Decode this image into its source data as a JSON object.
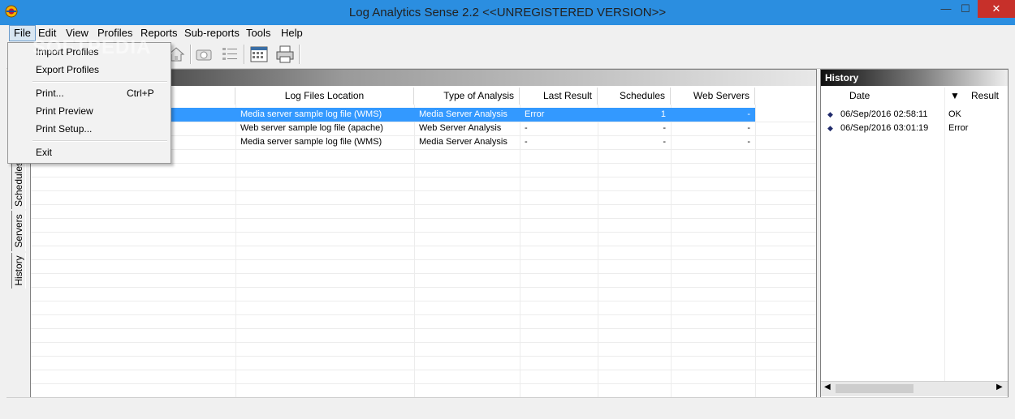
{
  "window": {
    "title": "Log Analytics Sense 2.2 <<UNREGISTERED VERSION>>",
    "controls": {
      "minimize": "—",
      "maximize": "☐",
      "close": "✕"
    }
  },
  "menubar": [
    "File",
    "Edit",
    "View",
    "Profiles",
    "Reports",
    "Sub-reports",
    "Tools",
    "Help"
  ],
  "toolbar": {
    "icons": [
      "home-icon",
      "camera-icon",
      "list-icon",
      "calendar-icon",
      "print-icon"
    ]
  },
  "file_menu": {
    "items": [
      {
        "label": "Import Profiles",
        "shortcut": ""
      },
      {
        "label": "Export Profiles",
        "shortcut": ""
      },
      {
        "label": "Print...",
        "shortcut": "Ctrl+P"
      },
      {
        "label": "Print Preview",
        "shortcut": ""
      },
      {
        "label": "Print Setup...",
        "shortcut": ""
      },
      {
        "label": "Exit",
        "shortcut": ""
      }
    ]
  },
  "side_tabs": [
    "Schedules",
    "Servers",
    "History"
  ],
  "profiles_table": {
    "columns": [
      "Log Files Location",
      "Type of Analysis",
      "Last Result",
      "Schedules",
      "Web Servers"
    ],
    "rows": [
      [
        "Media server sample log file (WMS)",
        "Media Server Analysis",
        "Error",
        "1",
        "-"
      ],
      [
        "Web server sample log file (apache)",
        "Web Server Analysis",
        "-",
        "-",
        "-"
      ],
      [
        "Media server sample log file (WMS)",
        "Media Server Analysis",
        "-",
        "-",
        "-"
      ]
    ]
  },
  "history": {
    "title": "History",
    "columns": [
      "Date",
      "Result"
    ],
    "sort_icon": "▼",
    "rows": [
      {
        "date": "06/Sep/2016 02:58:11",
        "result": "OK"
      },
      {
        "date": "06/Sep/2016 03:01:19",
        "result": "Error"
      }
    ]
  },
  "watermark": "SOFTPEDIA",
  "colors": {
    "titlebar": "#2b8ee0",
    "selection": "#3399ff",
    "close_button": "#c7302a"
  }
}
